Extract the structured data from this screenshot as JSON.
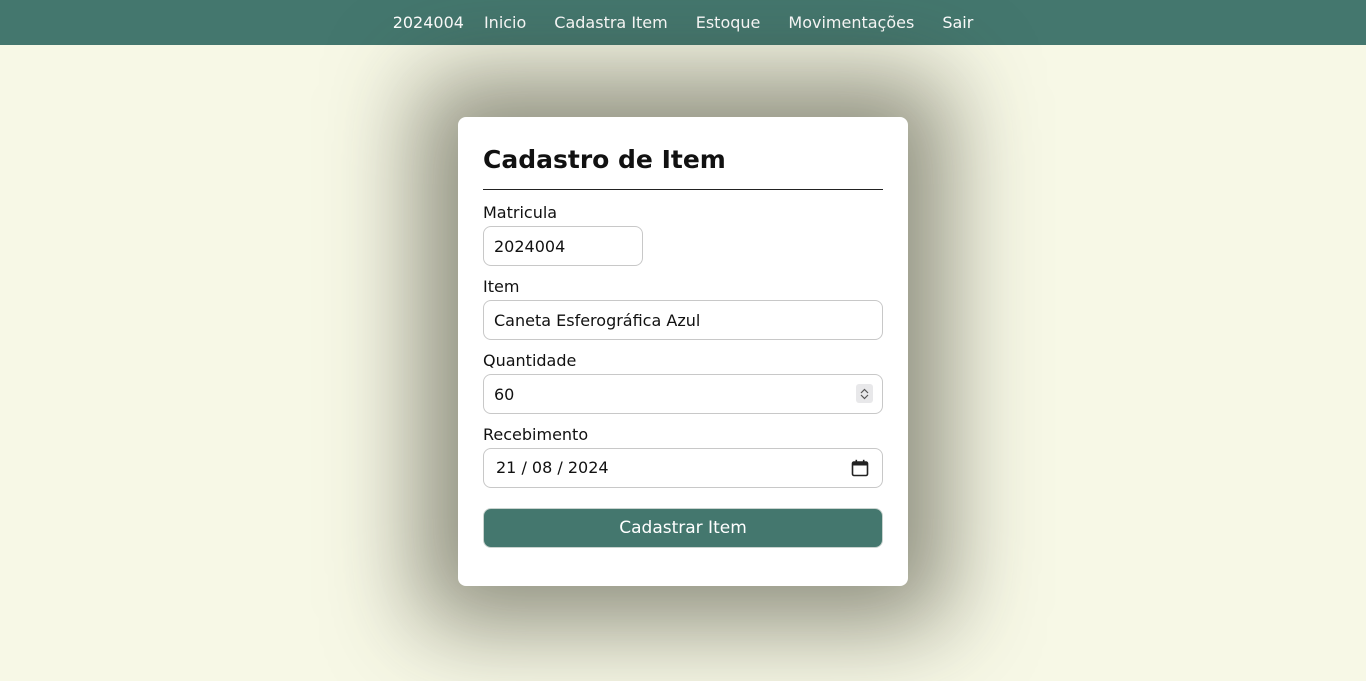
{
  "nav": {
    "user": "2024004",
    "links": [
      "Inicio",
      "Cadastra Item",
      "Estoque",
      "Movimentações",
      "Sair"
    ]
  },
  "form": {
    "title": "Cadastro de Item",
    "matricula": {
      "label": "Matricula",
      "value": "2024004"
    },
    "item": {
      "label": "Item",
      "value": "Caneta Esferográfica Azul"
    },
    "quantidade": {
      "label": "Quantidade",
      "value": "60"
    },
    "recebimento": {
      "label": "Recebimento",
      "value": "21 / 08 / 2024",
      "icon": "calendar-icon"
    },
    "submit_label": "Cadastrar Item"
  },
  "colors": {
    "accent": "#44776e",
    "background": "#f7f8e6",
    "card": "#ffffff"
  }
}
